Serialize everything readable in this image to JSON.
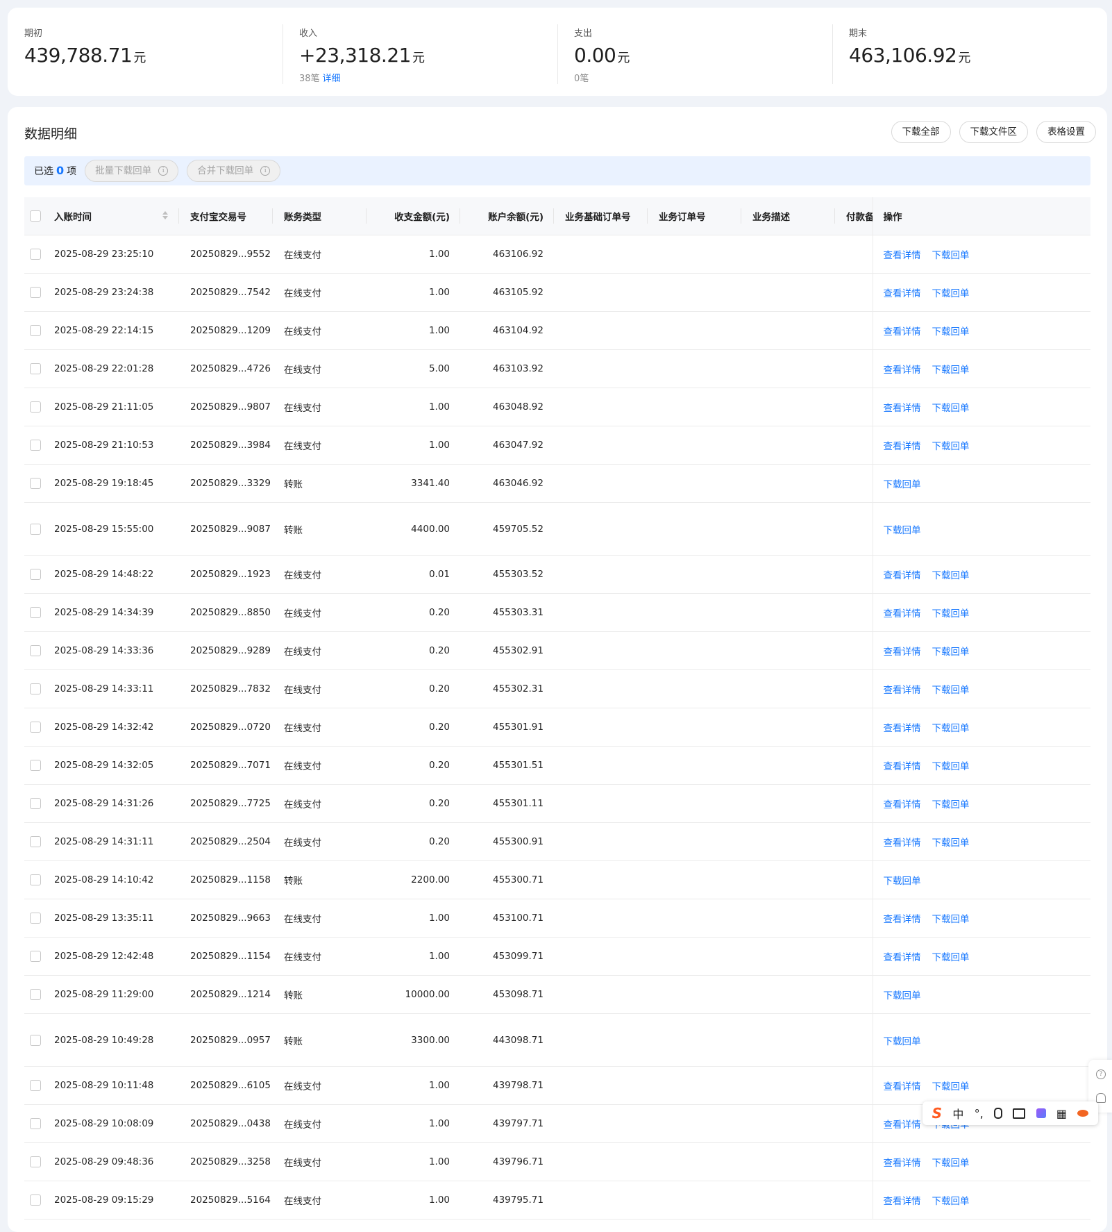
{
  "summary": {
    "opening": {
      "label": "期初",
      "value": "439,788.71",
      "unit": "元"
    },
    "income": {
      "label": "收入",
      "value": "+23,318.21",
      "unit": "元",
      "count": "38笔",
      "link": "详细"
    },
    "expense": {
      "label": "支出",
      "value": "0.00",
      "unit": "元",
      "count": "0笔"
    },
    "closing": {
      "label": "期末",
      "value": "463,106.92",
      "unit": "元"
    }
  },
  "panel": {
    "title": "数据明细",
    "toolbar": {
      "download_all": "下载全部",
      "download_area": "下载文件区",
      "table_settings": "表格设置"
    },
    "selection": {
      "prefix": "已选",
      "count": "0",
      "suffix": "项",
      "batch_download": "批量下载回单",
      "merge_download": "合并下载回单"
    }
  },
  "table": {
    "headers": {
      "time": "入账时间",
      "trade_no": "支付宝交易号",
      "type": "账务类型",
      "amount": "收支金额(元)",
      "balance": "账户余额(元)",
      "base_order": "业务基础订单号",
      "order": "业务订单号",
      "desc": "业务描述",
      "payer": "付款备",
      "actions": "操作"
    },
    "action_labels": {
      "detail": "查看详情",
      "receipt": "下载回单"
    },
    "rows": [
      {
        "time": "2025-08-29 23:25:10",
        "trade_no": "20250829...9552",
        "type": "在线支付",
        "amount": "1.00",
        "balance": "463106.92",
        "detail": true
      },
      {
        "time": "2025-08-29 23:24:38",
        "trade_no": "20250829...7542",
        "type": "在线支付",
        "amount": "1.00",
        "balance": "463105.92",
        "detail": true
      },
      {
        "time": "2025-08-29 22:14:15",
        "trade_no": "20250829...1209",
        "type": "在线支付",
        "amount": "1.00",
        "balance": "463104.92",
        "detail": true
      },
      {
        "time": "2025-08-29 22:01:28",
        "trade_no": "20250829...4726",
        "type": "在线支付",
        "amount": "5.00",
        "balance": "463103.92",
        "detail": true
      },
      {
        "time": "2025-08-29 21:11:05",
        "trade_no": "20250829...9807",
        "type": "在线支付",
        "amount": "1.00",
        "balance": "463048.92",
        "detail": true
      },
      {
        "time": "2025-08-29 21:10:53",
        "trade_no": "20250829...3984",
        "type": "在线支付",
        "amount": "1.00",
        "balance": "463047.92",
        "detail": true
      },
      {
        "time": "2025-08-29 19:18:45",
        "trade_no": "20250829...3329",
        "type": "转账",
        "amount": "3341.40",
        "balance": "463046.92",
        "detail": false
      },
      {
        "time": "2025-08-29 15:55:00",
        "trade_no": "20250829...9087",
        "type": "转账",
        "amount": "4400.00",
        "balance": "459705.52",
        "detail": false,
        "tall": true
      },
      {
        "time": "2025-08-29 14:48:22",
        "trade_no": "20250829...1923",
        "type": "在线支付",
        "amount": "0.01",
        "balance": "455303.52",
        "detail": true
      },
      {
        "time": "2025-08-29 14:34:39",
        "trade_no": "20250829...8850",
        "type": "在线支付",
        "amount": "0.20",
        "balance": "455303.31",
        "detail": true
      },
      {
        "time": "2025-08-29 14:33:36",
        "trade_no": "20250829...9289",
        "type": "在线支付",
        "amount": "0.20",
        "balance": "455302.91",
        "detail": true
      },
      {
        "time": "2025-08-29 14:33:11",
        "trade_no": "20250829...7832",
        "type": "在线支付",
        "amount": "0.20",
        "balance": "455302.31",
        "detail": true
      },
      {
        "time": "2025-08-29 14:32:42",
        "trade_no": "20250829...0720",
        "type": "在线支付",
        "amount": "0.20",
        "balance": "455301.91",
        "detail": true
      },
      {
        "time": "2025-08-29 14:32:05",
        "trade_no": "20250829...7071",
        "type": "在线支付",
        "amount": "0.20",
        "balance": "455301.51",
        "detail": true
      },
      {
        "time": "2025-08-29 14:31:26",
        "trade_no": "20250829...7725",
        "type": "在线支付",
        "amount": "0.20",
        "balance": "455301.11",
        "detail": true
      },
      {
        "time": "2025-08-29 14:31:11",
        "trade_no": "20250829...2504",
        "type": "在线支付",
        "amount": "0.20",
        "balance": "455300.91",
        "detail": true
      },
      {
        "time": "2025-08-29 14:10:42",
        "trade_no": "20250829...1158",
        "type": "转账",
        "amount": "2200.00",
        "balance": "455300.71",
        "detail": false
      },
      {
        "time": "2025-08-29 13:35:11",
        "trade_no": "20250829...9663",
        "type": "在线支付",
        "amount": "1.00",
        "balance": "453100.71",
        "detail": true
      },
      {
        "time": "2025-08-29 12:42:48",
        "trade_no": "20250829...1154",
        "type": "在线支付",
        "amount": "1.00",
        "balance": "453099.71",
        "detail": true
      },
      {
        "time": "2025-08-29 11:29:00",
        "trade_no": "20250829...1214",
        "type": "转账",
        "amount": "10000.00",
        "balance": "453098.71",
        "detail": false
      },
      {
        "time": "2025-08-29 10:49:28",
        "trade_no": "20250829...0957",
        "type": "转账",
        "amount": "3300.00",
        "balance": "443098.71",
        "detail": false,
        "tall": true
      },
      {
        "time": "2025-08-29 10:11:48",
        "trade_no": "20250829...6105",
        "type": "在线支付",
        "amount": "1.00",
        "balance": "439798.71",
        "detail": true
      },
      {
        "time": "2025-08-29 10:08:09",
        "trade_no": "20250829...0438",
        "type": "在线支付",
        "amount": "1.00",
        "balance": "439797.71",
        "detail": true
      },
      {
        "time": "2025-08-29 09:48:36",
        "trade_no": "20250829...3258",
        "type": "在线支付",
        "amount": "1.00",
        "balance": "439796.71",
        "detail": true
      },
      {
        "time": "2025-08-29 09:15:29",
        "trade_no": "20250829...5164",
        "type": "在线支付",
        "amount": "1.00",
        "balance": "439795.71",
        "detail": true
      }
    ]
  },
  "ime_toolbar": {
    "mode": "中",
    "punct": "°,"
  },
  "icons": {
    "info": "info-circle-icon",
    "help": "help-icon",
    "headset": "headset-icon",
    "sort": "sort-icon"
  },
  "colors": {
    "accent": "#1677ff",
    "selection_bar": "#eaf2ff",
    "ime_logo": "#ff5a1f"
  }
}
